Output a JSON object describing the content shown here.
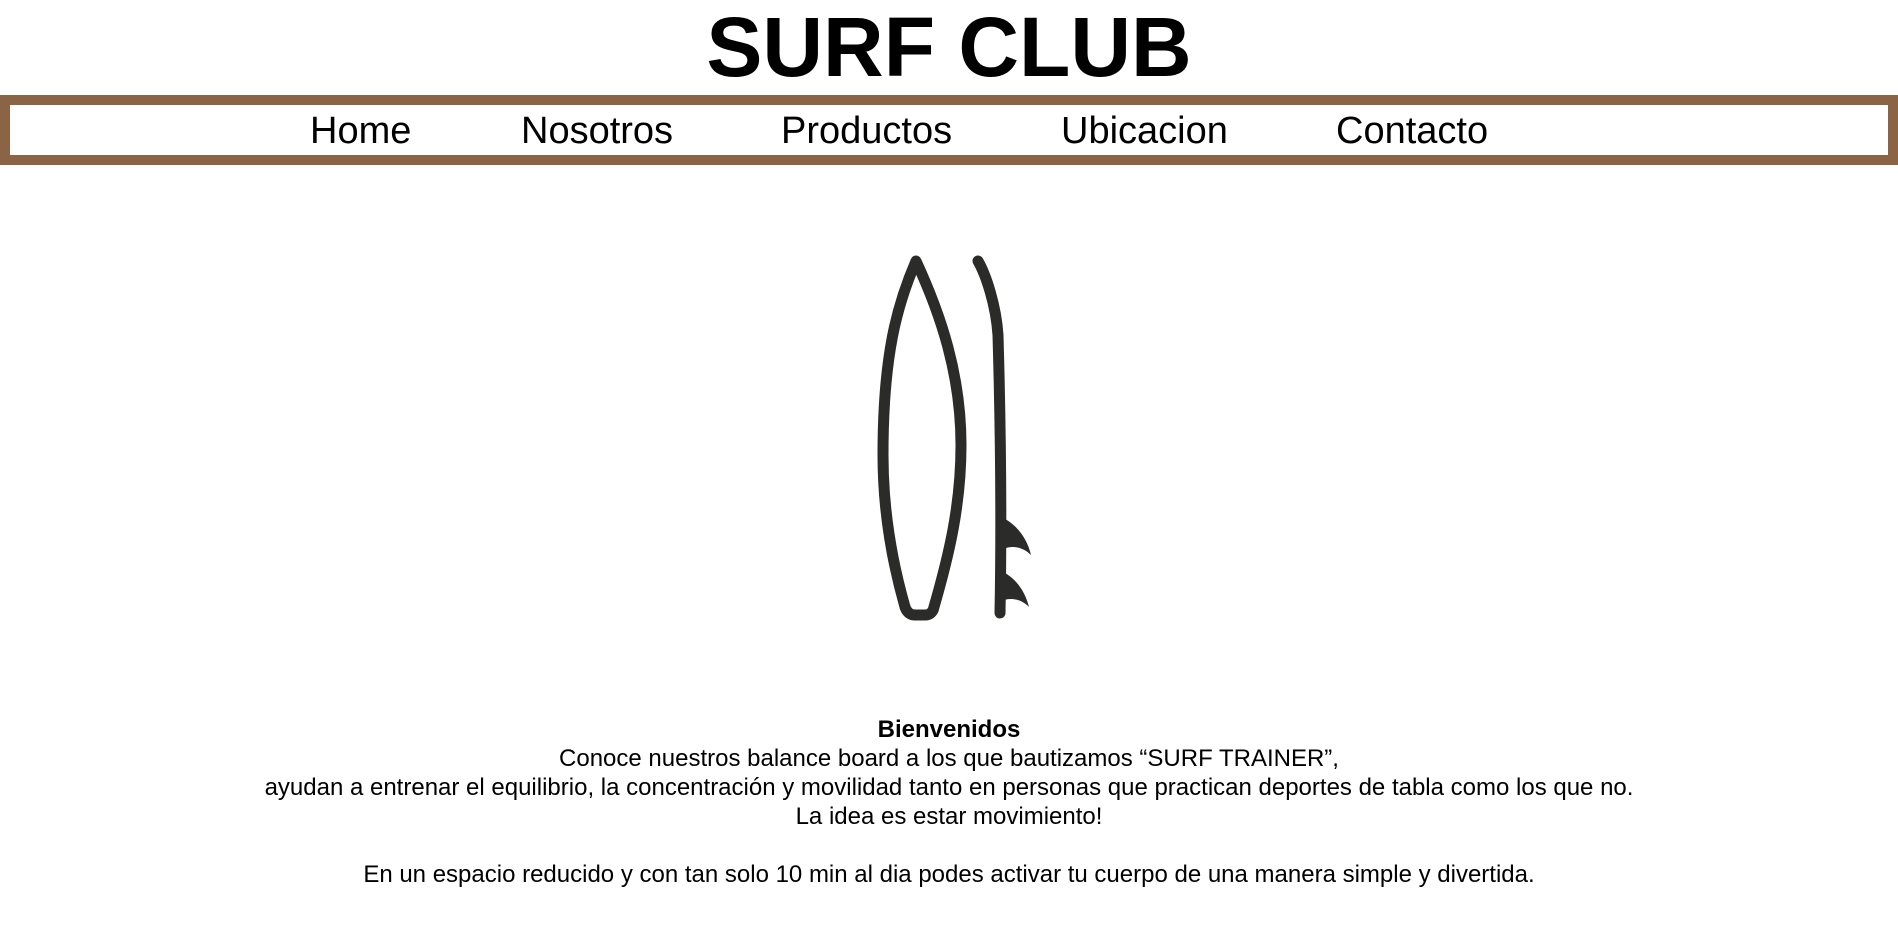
{
  "header": {
    "title": "SURF CLUB"
  },
  "nav": {
    "items": [
      {
        "label": "Home"
      },
      {
        "label": "Nosotros"
      },
      {
        "label": "Productos"
      },
      {
        "label": "Ubicacion"
      },
      {
        "label": "Contacto"
      }
    ],
    "border_color": "#8b6445"
  },
  "hero": {
    "icon": "surfboard-icon",
    "icon_color": "#2b2b29"
  },
  "intro": {
    "heading": "Bienvenidos",
    "line1": "Conoce nuestros balance board a los que bautizamos “SURF TRAINER”,",
    "line2": "ayudan a entrenar el equilibrio, la concentración y movilidad tanto en personas que practican deportes de tabla como los que no.",
    "line3": "La idea es estar movimiento!",
    "line4": "En un espacio reducido y con tan solo 10 min al dia podes activar tu cuerpo de una manera simple y divertida."
  }
}
